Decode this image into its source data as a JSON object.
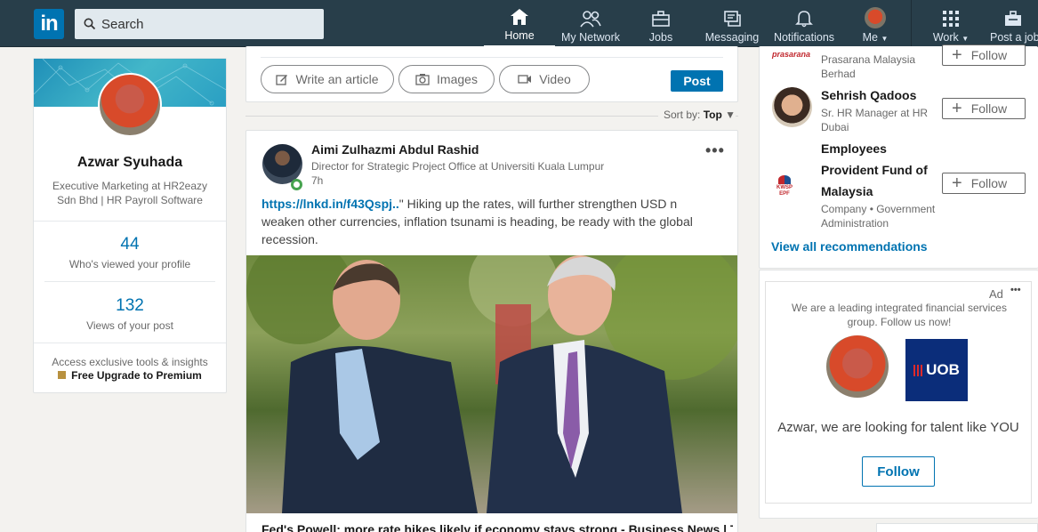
{
  "nav": {
    "logo": "in",
    "search_placeholder": "Search",
    "items": [
      {
        "label": "Home"
      },
      {
        "label": "My Network"
      },
      {
        "label": "Jobs"
      },
      {
        "label": "Messaging"
      },
      {
        "label": "Notifications"
      },
      {
        "label": "Me"
      },
      {
        "label": "Work"
      },
      {
        "label": "Post a job"
      }
    ]
  },
  "profile": {
    "name": "Azwar Syuhada",
    "headline": "Executive Marketing at HR2eazy Sdn Bhd | HR Payroll Software",
    "stats": [
      {
        "value": "44",
        "label": "Who's viewed your profile"
      },
      {
        "value": "132",
        "label": "Views of your post"
      }
    ],
    "premium_text": "Access exclusive tools & insights",
    "premium_link": "Free Upgrade to Premium"
  },
  "share": {
    "write_article": "Write an article",
    "images": "Images",
    "video": "Video",
    "post": "Post"
  },
  "sort": {
    "label": "Sort by:",
    "value": "Top"
  },
  "feed_post": {
    "author": "Aimi Zulhazmi Abdul Rashid",
    "author_title": "Director for Strategic Project Office at Universiti Kuala Lumpur",
    "time": "7h",
    "link": "https://lnkd.in/f43Qspj..",
    "text": "\" Hiking up the rates, will further strengthen USD n weaken other currencies, inflation tsunami is heading, be ready with the global recession.",
    "article_title": "Fed's Powell: more rate hikes likely if economy stays strong - Business News | The"
  },
  "recommendations": {
    "items": [
      {
        "name": "",
        "logo_text": "prasarana",
        "subtitle": "Prasarana Malaysia Berhad",
        "button": "Follow"
      },
      {
        "name": "Sehrish Qadoos",
        "subtitle": "Sr. HR Manager at HR Dubai",
        "button": "Follow"
      },
      {
        "name": "Employees Provident Fund of Malaysia",
        "logo_text": "KWSP EPF",
        "subtitle": "Company • Government Administration",
        "button": "Follow"
      }
    ],
    "view_all": "View all recommendations"
  },
  "ad": {
    "label": "Ad",
    "tagline": "We are a leading integrated financial services group. Follow us now!",
    "brand": "UOB",
    "headline": "Azwar, we are looking for talent like YOU",
    "button": "Follow"
  },
  "colors": {
    "nav_bg": "#283e4a",
    "accent": "#0073b1",
    "uob_blue": "#005eb8"
  }
}
